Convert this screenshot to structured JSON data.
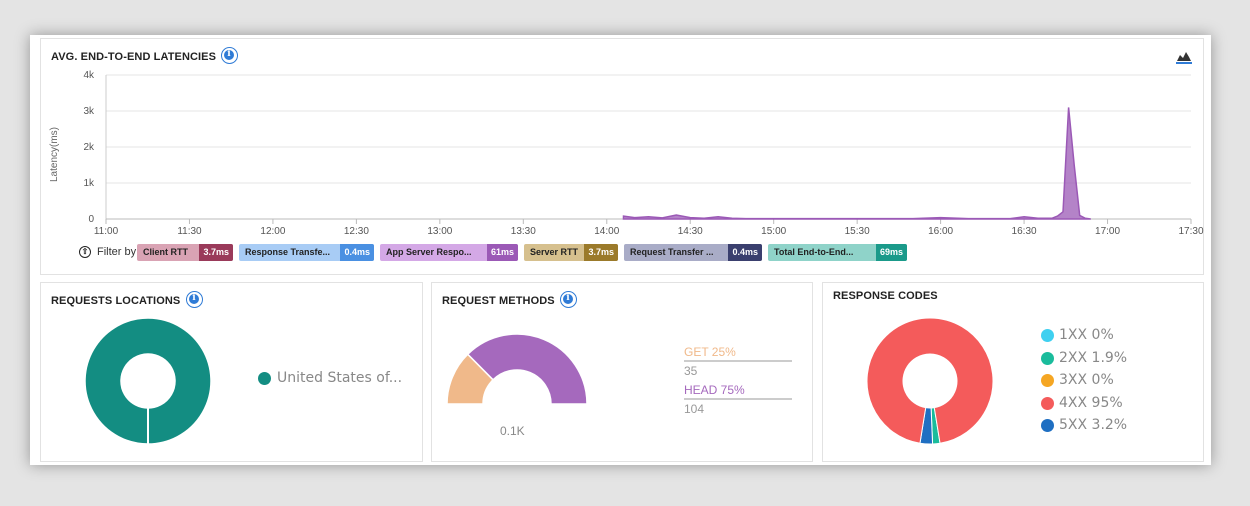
{
  "latency": {
    "title": "AVG. END-TO-END LATENCIES",
    "filter_label": "Filter by",
    "filters": [
      {
        "label": "Client RTT",
        "value": "3.7ms",
        "bg": "#d9a3b4",
        "valbg": "#9a3a5a"
      },
      {
        "label": "Response Transfe...",
        "value": "0.4ms",
        "bg": "#a8ccf5",
        "valbg": "#4a90e2"
      },
      {
        "label": "App Server Respo...",
        "value": "61ms",
        "bg": "#d4a8e6",
        "valbg": "#9b59b6"
      },
      {
        "label": "Server RTT",
        "value": "3.7ms",
        "bg": "#d6c08e",
        "valbg": "#9b7a2a"
      },
      {
        "label": "Request Transfer ...",
        "value": "0.4ms",
        "bg": "#a9acc7",
        "valbg": "#3a3f6e"
      },
      {
        "label": "Total End-to-End...",
        "value": "69ms",
        "bg": "#8fd3c9",
        "valbg": "#1a9a8a"
      }
    ]
  },
  "locations": {
    "title": "REQUESTS LOCATIONS",
    "legend": "United States of...",
    "color": "#138d82"
  },
  "methods": {
    "title": "REQUEST METHODS",
    "total_label": "0.1K",
    "items": [
      {
        "label": "GET 25%",
        "count": "35",
        "color": "#f0b98a"
      },
      {
        "label": "HEAD 75%",
        "count": "104",
        "color": "#a569bd"
      }
    ]
  },
  "codes": {
    "title": "RESPONSE CODES",
    "items": [
      {
        "label": "1XX 0%",
        "color": "#3fd0f0"
      },
      {
        "label": "2XX 1.9%",
        "color": "#1abc9c"
      },
      {
        "label": "3XX 0%",
        "color": "#f5a623"
      },
      {
        "label": "4XX 95%",
        "color": "#f45b5b"
      },
      {
        "label": "5XX 3.2%",
        "color": "#1f6fc2"
      }
    ]
  },
  "chart_data": [
    {
      "type": "area",
      "title": "AVG. END-TO-END LATENCIES",
      "ylabel": "Latency(ms)",
      "ylim": [
        0,
        4000
      ],
      "yticks": [
        "0",
        "1k",
        "2k",
        "3k",
        "4k"
      ],
      "xticks": [
        "11:00",
        "11:30",
        "12:00",
        "12:30",
        "13:00",
        "13:30",
        "14:00",
        "14:30",
        "15:00",
        "15:30",
        "16:00",
        "16:30",
        "17:00",
        "17:30"
      ],
      "grid": true,
      "series": [
        {
          "name": "App Server Respo...",
          "color": "#9b59b6",
          "x": [
            "14:06",
            "14:10",
            "14:15",
            "14:20",
            "14:25",
            "14:30",
            "14:35",
            "14:40",
            "14:45",
            "14:50",
            "14:55",
            "15:00",
            "15:10",
            "15:20",
            "15:30",
            "15:40",
            "15:50",
            "16:00",
            "16:10",
            "16:20",
            "16:25",
            "16:30",
            "16:35",
            "16:40",
            "16:42",
            "16:44",
            "16:46",
            "16:48",
            "16:50",
            "16:52",
            "16:54"
          ],
          "y": [
            80,
            40,
            60,
            30,
            110,
            40,
            20,
            60,
            20,
            10,
            10,
            10,
            10,
            10,
            10,
            10,
            10,
            40,
            10,
            10,
            10,
            60,
            20,
            20,
            80,
            200,
            3100,
            1500,
            100,
            20,
            0
          ]
        }
      ]
    },
    {
      "type": "pie",
      "title": "REQUESTS LOCATIONS",
      "categories": [
        "United States of..."
      ],
      "values": [
        100
      ]
    },
    {
      "type": "pie",
      "title": "REQUEST METHODS",
      "categories": [
        "GET",
        "HEAD"
      ],
      "values": [
        35,
        104
      ]
    },
    {
      "type": "pie",
      "title": "RESPONSE CODES",
      "categories": [
        "1XX",
        "2XX",
        "3XX",
        "4XX",
        "5XX"
      ],
      "values": [
        0,
        1.9,
        0,
        95,
        3.2
      ]
    }
  ]
}
